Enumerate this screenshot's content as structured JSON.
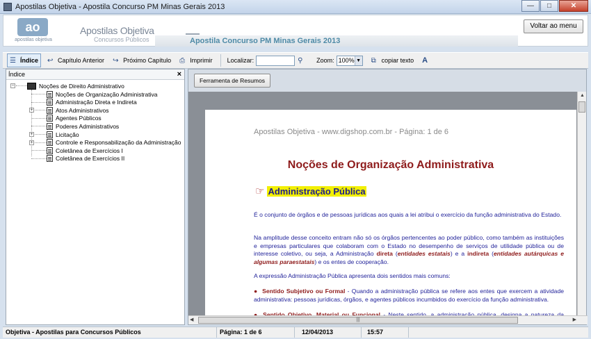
{
  "window": {
    "title": "Apostilas Objetiva - Apostila Concurso PM Minas Gerais 2013",
    "minimize": "—",
    "maximize": "□",
    "close": "✕"
  },
  "header": {
    "logo_mark": "ao",
    "logo_sub": "apostilas objetiva",
    "brand": "Apostilas Objetiva",
    "brand_sub": "Concursos Públicos",
    "banner_title": "Apostila Concurso PM Minas Gerais 2013",
    "back_button": "Voltar ao menu"
  },
  "toolbar": {
    "index": "Índice",
    "prev_chapter": "Capítulo Anterior",
    "next_chapter": "Próximo Capítulo",
    "print": "Imprimir",
    "find_label": "Localizar:",
    "find_value": "",
    "zoom_label": "Zoom:",
    "zoom_value": "100%",
    "copy_text": "copiar texto",
    "font_icon_label": "A"
  },
  "index_panel": {
    "title": "Índice",
    "close": "×",
    "root": "Noções de Direito Administrativo",
    "items": [
      {
        "label": "Noções de Organização Administrativa",
        "expandable": false
      },
      {
        "label": "Administração Direta e Indireta",
        "expandable": false
      },
      {
        "label": "Atos Administrativos",
        "expandable": true
      },
      {
        "label": "Agentes Públicos",
        "expandable": false
      },
      {
        "label": "Poderes Administrativos",
        "expandable": false
      },
      {
        "label": "Licitação",
        "expandable": true
      },
      {
        "label": "Controle e Responsabilização da Administração",
        "expandable": true
      },
      {
        "label": "Coletânea de Exercícios I",
        "expandable": false
      },
      {
        "label": "Coletânea de Exercícios II",
        "expandable": false
      }
    ]
  },
  "content": {
    "tool_button": "Ferramenta de Resumos",
    "page_header": "Apostilas Objetiva - www.digshop.com.br - Página: 1 de 6",
    "page_title": "Noções de Organização Administrativa",
    "section_title": "Administração Pública",
    "p1": "É o conjunto de órgãos e de pessoas jurídicas aos quais  a lei atribui o exercício da função administrativa do Estado.",
    "p2_a": "Na amplitude desse conceito entram não só os órgãos pertencentes ao poder público, como também as instituições e empresas particulares que colaboram com o Estado no desempenho de serviços de utilidade pública ou de interesse coletivo, ou seja, a Administração ",
    "p2_direta": "direta",
    "p2_b": " (",
    "p2_estatais": "entidades estatais",
    "p2_c": ") e a ",
    "p2_indireta": "indireta",
    "p2_d": " (",
    "p2_autarquicas": "entidades autárquicas e algumas paraestatais",
    "p2_e": ") e os entes de cooperação.",
    "p3": "A expressão Administração Pública apresenta dois sentidos mais comuns:",
    "b1_title": "Sentido Subjetivo ou Formal",
    "b1_text": " - Quando a administração pública se refere aos entes que exercem a atividade administrativa: pessoas jurídicas, órgãos, e agentes públicos incumbidos do exercício da função administrativa.",
    "b2_title": "Sentido Objetivo, Material ou Funcional",
    "b2_text": " - Neste sentido, a administração pública, designa a natureza da atividade exercida pelos referidos entes, ou seja, as funções necessárias aos serviços",
    "bullet": "●"
  },
  "statusbar": {
    "app": "Objetiva - Apostilas para Concursos Públicos",
    "page": "Página:  1 de 6",
    "date": "12/04/2013",
    "time": "15:57"
  }
}
